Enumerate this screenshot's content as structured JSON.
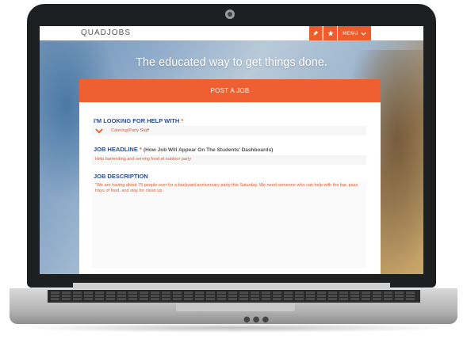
{
  "app": {
    "logo": "QUADJOBS",
    "menu_label": "MENU"
  },
  "hero": {
    "title": "The educated way to get things done."
  },
  "form": {
    "header": "POST A JOB",
    "help_label": "I'M LOOKING FOR HELP WITH",
    "help_required": "*",
    "help_value": "Catering/Party Staff",
    "headline_label": "JOB HEADLINE",
    "headline_required": "*",
    "headline_hint": "(How Job Will Appear On The Students' Dashboards)",
    "headline_value": "Help bartending and serving food at outdoor party",
    "description_label": "JOB DESCRIPTION",
    "description_value": "\"We are having about 75 people over for a backyard anniversary party this Saturday. We need someone who can help with the bar, pass trays of food, and stay for clean up."
  },
  "icons": {
    "pin": "pin-icon",
    "star": "star-icon",
    "menu_chevron": "chevron-down-icon",
    "select_chevron": "chevron-down-icon"
  },
  "colors": {
    "accent": "#ee5f31",
    "label": "#2d4d8f"
  }
}
